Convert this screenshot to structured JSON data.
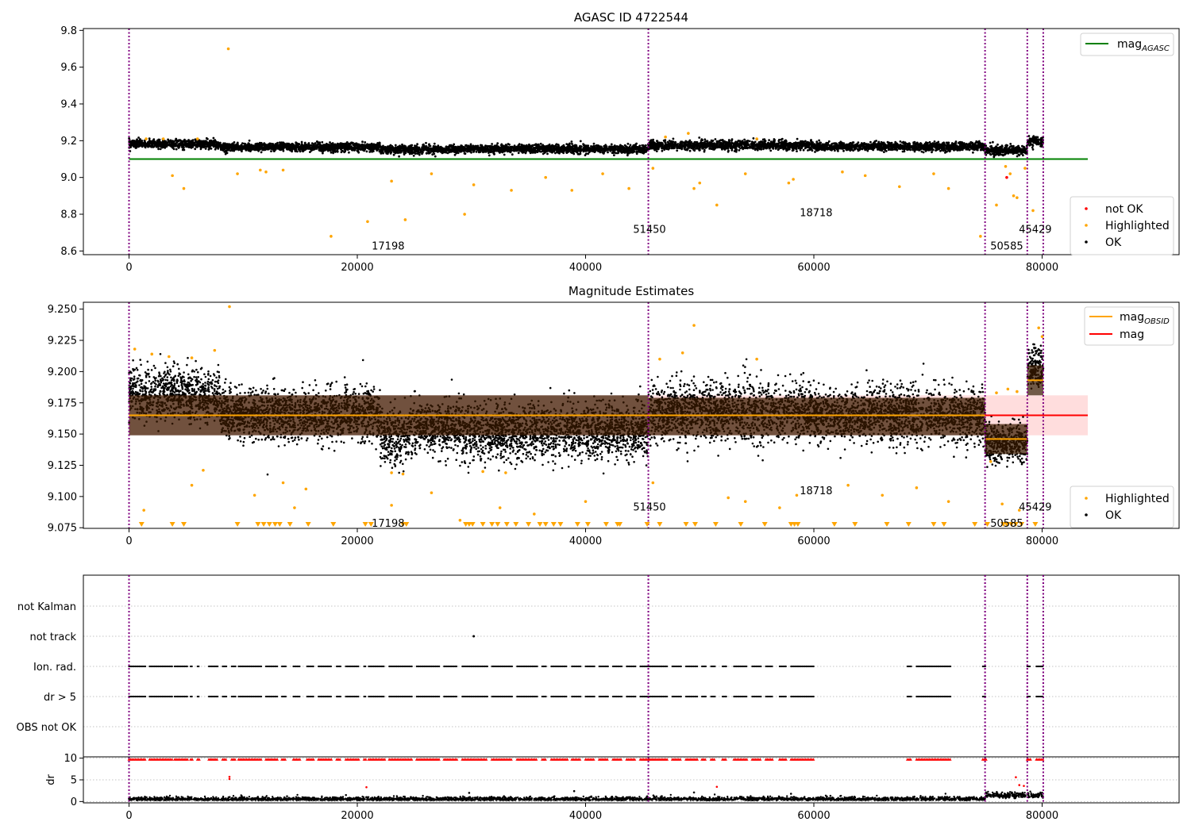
{
  "colors": {
    "ok": "#000000",
    "highlighted": "#ffa500",
    "not_ok": "#ff0000",
    "agasc_line": "#008000",
    "mag_line": "#ff0000",
    "obsid_line": "#ffa500",
    "obsid_band": "#3a1a00",
    "mag_band": "#ffb3b3",
    "obs_boundary": "#800080",
    "grid": "#b0b0b0"
  },
  "chart_data": [
    {
      "type": "scatter",
      "title": "AGASC ID 4722544",
      "xlabel": "",
      "ylabel": "",
      "xlim": [
        -4000,
        92000
      ],
      "ylim": [
        8.58,
        9.81
      ],
      "xticks": [
        0,
        20000,
        40000,
        60000,
        80000
      ],
      "yticks": [
        8.6,
        8.8,
        9.0,
        9.2,
        9.4,
        9.6,
        9.8
      ],
      "ytick_labels": [
        "8.6",
        "8.8",
        "9.0",
        "9.2",
        "9.4",
        "9.6",
        "9.8"
      ],
      "mag_agasc": 9.1,
      "mag_agasc_xrange": [
        0,
        84000
      ],
      "obs_boundaries": [
        0,
        45500,
        75000,
        78700,
        80100
      ],
      "obs_labels": [
        {
          "text": "17198",
          "x": 22700,
          "y": 8.63
        },
        {
          "text": "51450",
          "x": 45600,
          "y": 8.72
        },
        {
          "text": "18718",
          "x": 60200,
          "y": 8.81
        },
        {
          "text": "50585",
          "x": 76900,
          "y": 8.63
        },
        {
          "text": "45429",
          "x": 79400,
          "y": 8.72
        }
      ],
      "ok_segments": [
        {
          "x0": 0,
          "x1": 8000,
          "center": 9.182,
          "spread": 0.04
        },
        {
          "x0": 8000,
          "x1": 22000,
          "center": 9.165,
          "spread": 0.04
        },
        {
          "x0": 22000,
          "x1": 29000,
          "center": 9.152,
          "spread": 0.04
        },
        {
          "x0": 29000,
          "x1": 45500,
          "center": 9.155,
          "spread": 0.04
        },
        {
          "x0": 45500,
          "x1": 60000,
          "center": 9.175,
          "spread": 0.045
        },
        {
          "x0": 60000,
          "x1": 75000,
          "center": 9.168,
          "spread": 0.04
        },
        {
          "x0": 75000,
          "x1": 78700,
          "center": 9.147,
          "spread": 0.045
        },
        {
          "x0": 78700,
          "x1": 80100,
          "center": 9.195,
          "spread": 0.045
        }
      ],
      "highlighted_points": [
        [
          8700,
          9.7
        ],
        [
          17700,
          8.68
        ],
        [
          20900,
          8.76
        ],
        [
          24200,
          8.77
        ],
        [
          29400,
          8.8
        ],
        [
          3800,
          9.01
        ],
        [
          4800,
          8.94
        ],
        [
          9500,
          9.02
        ],
        [
          11500,
          9.04
        ],
        [
          12000,
          9.03
        ],
        [
          13500,
          9.04
        ],
        [
          23000,
          8.98
        ],
        [
          26500,
          9.02
        ],
        [
          30200,
          8.96
        ],
        [
          33500,
          8.93
        ],
        [
          36500,
          9.0
        ],
        [
          38800,
          8.93
        ],
        [
          41500,
          9.02
        ],
        [
          43800,
          8.94
        ],
        [
          49500,
          8.94
        ],
        [
          50000,
          8.97
        ],
        [
          51500,
          8.85
        ],
        [
          57800,
          8.97
        ],
        [
          58200,
          8.99
        ],
        [
          67500,
          8.95
        ],
        [
          71800,
          8.94
        ],
        [
          74600,
          8.68
        ],
        [
          76000,
          8.85
        ],
        [
          77500,
          8.9
        ],
        [
          77800,
          8.89
        ],
        [
          78500,
          9.05
        ],
        [
          79200,
          8.82
        ],
        [
          77200,
          9.02
        ],
        [
          76800,
          9.06
        ],
        [
          49000,
          9.24
        ],
        [
          1500,
          9.21
        ],
        [
          3000,
          9.21
        ],
        [
          6000,
          9.21
        ],
        [
          47000,
          9.22
        ],
        [
          55000,
          9.21
        ],
        [
          64500,
          9.01
        ],
        [
          70500,
          9.02
        ],
        [
          54000,
          9.02
        ],
        [
          45900,
          9.05
        ],
        [
          62500,
          9.03
        ]
      ],
      "not_ok_points": [
        [
          76900,
          9.0
        ]
      ],
      "legend_lines": {
        "position": "upper right",
        "items": [
          {
            "label": "mag",
            "sub": "AGASC",
            "color": "#008000"
          }
        ]
      },
      "legend_points": {
        "position": "lower right",
        "items": [
          {
            "label": "not OK",
            "color": "#ff0000"
          },
          {
            "label": "Highlighted",
            "color": "#ffa500"
          },
          {
            "label": "OK",
            "color": "#000000"
          }
        ]
      }
    },
    {
      "type": "scatter",
      "title": "Magnitude Estimates",
      "xlabel": "",
      "ylabel": "",
      "xlim": [
        -4000,
        92000
      ],
      "ylim": [
        9.0745,
        9.2555
      ],
      "xticks": [
        0,
        20000,
        40000,
        60000,
        80000
      ],
      "yticks": [
        9.075,
        9.1,
        9.125,
        9.15,
        9.175,
        9.2,
        9.225,
        9.25
      ],
      "ytick_labels": [
        "9.075",
        "9.100",
        "9.125",
        "9.150",
        "9.175",
        "9.200",
        "9.225",
        "9.250"
      ],
      "mag": 9.165,
      "mag_band": [
        9.149,
        9.181
      ],
      "mag_xrange": [
        0,
        84000
      ],
      "obs_boundaries": [
        0,
        45500,
        75000,
        78700,
        80100
      ],
      "obsid_estimates": [
        {
          "x0": 0,
          "x1": 45500,
          "mag": 9.165,
          "band": [
            9.149,
            9.181
          ]
        },
        {
          "x0": 45500,
          "x1": 75000,
          "mag": 9.165,
          "band": [
            9.149,
            9.179
          ]
        },
        {
          "x0": 75000,
          "x1": 78700,
          "mag": 9.146,
          "band": [
            9.134,
            9.158
          ]
        },
        {
          "x0": 78700,
          "x1": 80100,
          "mag": 9.193,
          "band": [
            9.181,
            9.205
          ]
        }
      ],
      "obs_labels": [
        {
          "text": "17198",
          "x": 22700,
          "y": 9.079
        },
        {
          "text": "51450",
          "x": 45600,
          "y": 9.092
        },
        {
          "text": "18718",
          "x": 60200,
          "y": 9.105
        },
        {
          "text": "50585",
          "x": 76900,
          "y": 9.079
        },
        {
          "text": "45429",
          "x": 79400,
          "y": 9.092
        }
      ],
      "ok_segments": [
        {
          "x0": 0,
          "x1": 8000,
          "center": 9.182,
          "spread": 0.024
        },
        {
          "x0": 8000,
          "x1": 22000,
          "center": 9.166,
          "spread": 0.024
        },
        {
          "x0": 22000,
          "x1": 24500,
          "center": 9.148,
          "spread": 0.026
        },
        {
          "x0": 24500,
          "x1": 29000,
          "center": 9.155,
          "spread": 0.024
        },
        {
          "x0": 29000,
          "x1": 45500,
          "center": 9.152,
          "spread": 0.026
        },
        {
          "x0": 45500,
          "x1": 60000,
          "center": 9.168,
          "spread": 0.028
        },
        {
          "x0": 60000,
          "x1": 75000,
          "center": 9.165,
          "spread": 0.026
        },
        {
          "x0": 75000,
          "x1": 78700,
          "center": 9.143,
          "spread": 0.018
        },
        {
          "x0": 78700,
          "x1": 80100,
          "center": 9.203,
          "spread": 0.02
        }
      ],
      "highlighted_points": [
        [
          8800,
          9.252
        ],
        [
          49500,
          9.237
        ],
        [
          500,
          9.218
        ],
        [
          2000,
          9.214
        ],
        [
          3500,
          9.212
        ],
        [
          5500,
          9.211
        ],
        [
          7500,
          9.217
        ],
        [
          46500,
          9.21
        ],
        [
          48500,
          9.215
        ],
        [
          55000,
          9.21
        ],
        [
          79700,
          9.235
        ],
        [
          80000,
          9.228
        ],
        [
          1300,
          9.089
        ],
        [
          5500,
          9.109
        ],
        [
          6500,
          9.121
        ],
        [
          11000,
          9.101
        ],
        [
          13500,
          9.111
        ],
        [
          14500,
          9.091
        ],
        [
          15500,
          9.106
        ],
        [
          23000,
          9.093
        ],
        [
          26500,
          9.103
        ],
        [
          29000,
          9.081
        ],
        [
          32500,
          9.091
        ],
        [
          35500,
          9.086
        ],
        [
          40000,
          9.096
        ],
        [
          45900,
          9.111
        ],
        [
          52500,
          9.099
        ],
        [
          54000,
          9.096
        ],
        [
          57000,
          9.091
        ],
        [
          58500,
          9.101
        ],
        [
          63000,
          9.109
        ],
        [
          66000,
          9.101
        ],
        [
          69000,
          9.107
        ],
        [
          71800,
          9.096
        ],
        [
          76500,
          9.094
        ],
        [
          78000,
          9.089
        ],
        [
          23000,
          9.119
        ],
        [
          24000,
          9.118
        ],
        [
          31000,
          9.12
        ],
        [
          33000,
          9.119
        ],
        [
          75500,
          9.128
        ],
        [
          76000,
          9.183
        ],
        [
          77000,
          9.186
        ],
        [
          77800,
          9.184
        ]
      ],
      "below_axis_markers": [
        1100,
        3800,
        4800,
        9500,
        11300,
        11800,
        12300,
        12800,
        13200,
        14100,
        15700,
        17900,
        20700,
        21200,
        24000,
        24300,
        29500,
        29800,
        30100,
        31000,
        31800,
        32300,
        33100,
        33900,
        35000,
        36000,
        36500,
        37200,
        37800,
        39300,
        40200,
        41800,
        42800,
        43000,
        45400,
        46500,
        48800,
        49600,
        51400,
        53600,
        55700,
        58000,
        58300,
        58600,
        61800,
        63600,
        66400,
        68300,
        70500,
        71400,
        74100,
        75200,
        76600,
        76900,
        77300,
        77700,
        78200,
        79400
      ],
      "legend_lines": {
        "position": "upper right",
        "items": [
          {
            "label": "mag",
            "sub": "OBSID",
            "color": "#ffa500"
          },
          {
            "label": "mag",
            "sub": "",
            "color": "#ff0000"
          }
        ]
      },
      "legend_points": {
        "position": "lower right",
        "items": [
          {
            "label": "Highlighted",
            "color": "#ffa500"
          },
          {
            "label": "OK",
            "color": "#000000"
          }
        ]
      }
    },
    {
      "type": "scatter",
      "title": "",
      "xlabel": "",
      "ylabel": "",
      "xlim": [
        -4000,
        92000
      ],
      "categories": [
        "not Kalman",
        "not track",
        "Ion. rad.",
        "dr > 5",
        "OBS not OK"
      ],
      "obs_boundaries": [
        0,
        45500,
        75000,
        78700,
        80100
      ],
      "xticks": [],
      "flag_runs": [
        [
          0,
          1500
        ],
        [
          1800,
          3800
        ],
        [
          4000,
          5200
        ],
        [
          5400,
          5600
        ],
        [
          6000,
          6200
        ],
        [
          7000,
          7800
        ],
        [
          8200,
          8600
        ],
        [
          9000,
          9400
        ],
        [
          9600,
          11600
        ],
        [
          12000,
          13000
        ],
        [
          13400,
          13800
        ],
        [
          14400,
          15000
        ],
        [
          15600,
          16200
        ],
        [
          16600,
          17800
        ],
        [
          18200,
          18600
        ],
        [
          19000,
          20200
        ],
        [
          20600,
          20800
        ],
        [
          21000,
          22400
        ],
        [
          22800,
          24800
        ],
        [
          25200,
          27200
        ],
        [
          27600,
          28800
        ],
        [
          29200,
          31400
        ],
        [
          31800,
          33600
        ],
        [
          34000,
          35800
        ],
        [
          36200,
          36600
        ],
        [
          37000,
          38400
        ],
        [
          38800,
          39600
        ],
        [
          40000,
          40800
        ],
        [
          41200,
          42000
        ],
        [
          42400,
          43200
        ],
        [
          43600,
          44400
        ],
        [
          44800,
          45500
        ],
        [
          45600,
          47200
        ],
        [
          47600,
          48400
        ],
        [
          48800,
          49800
        ],
        [
          50200,
          50600
        ],
        [
          51000,
          51400
        ],
        [
          52000,
          52400
        ],
        [
          53000,
          54200
        ],
        [
          54600,
          55400
        ],
        [
          55800,
          56400
        ],
        [
          57000,
          57600
        ],
        [
          58000,
          60000
        ],
        [
          68200,
          68600
        ],
        [
          69000,
          72000
        ],
        [
          74800,
          75100
        ],
        [
          78700,
          79000
        ],
        [
          79500,
          80100
        ]
      ],
      "not_track_points": [
        [
          30200
        ]
      ]
    },
    {
      "type": "scatter",
      "title": "",
      "xlabel": "",
      "ylabel": "dr",
      "xlim": [
        -4000,
        92000
      ],
      "ylim": [
        -0.3,
        10.3
      ],
      "yticks": [
        0,
        5,
        10
      ],
      "ytick_labels": [
        "0",
        "5",
        "10"
      ],
      "xticks": [
        0,
        20000,
        40000,
        60000,
        80000
      ],
      "obs_boundaries": [
        0,
        45500,
        75000,
        78700,
        80100
      ],
      "dr_baseline": 0.6,
      "dr_capped": 9.7,
      "red_points": [
        [
          8800,
          5.7
        ],
        [
          8800,
          5.2
        ],
        [
          20800,
          3.3
        ],
        [
          51500,
          3.4
        ],
        [
          77700,
          5.6
        ],
        [
          78000,
          3.8
        ],
        [
          78400,
          3.6
        ]
      ],
      "black_outliers": [
        [
          29800,
          2.0
        ],
        [
          39000,
          2.4
        ],
        [
          45400,
          1.2
        ],
        [
          49500,
          2.1
        ],
        [
          58000,
          1.8
        ]
      ]
    }
  ]
}
